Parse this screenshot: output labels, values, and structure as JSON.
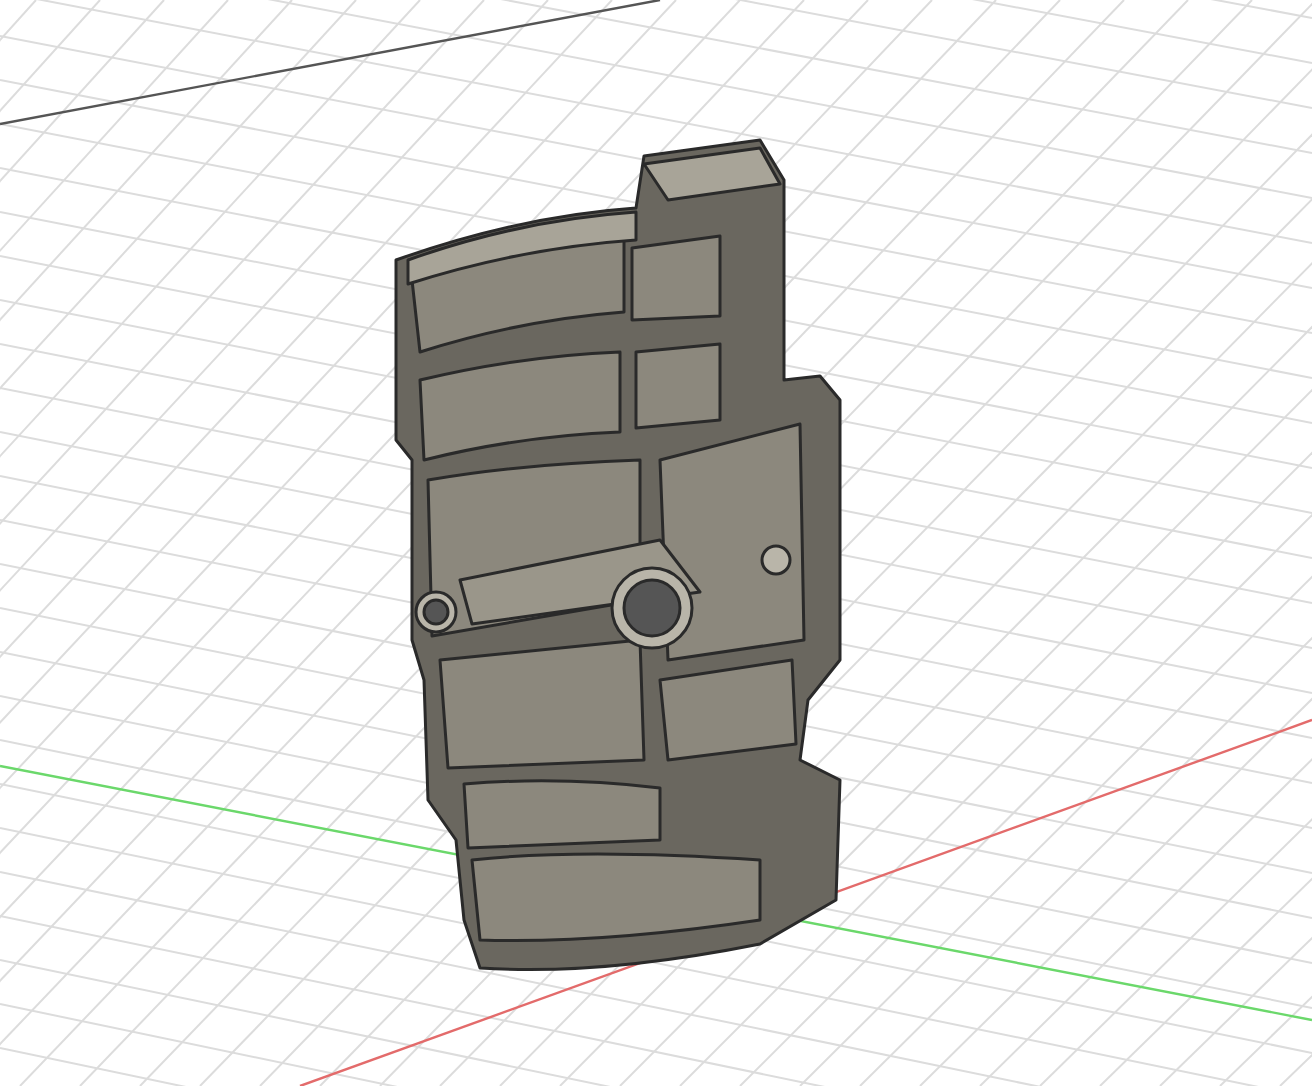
{
  "viewport": {
    "show_grid": true,
    "show_axes": true
  }
}
